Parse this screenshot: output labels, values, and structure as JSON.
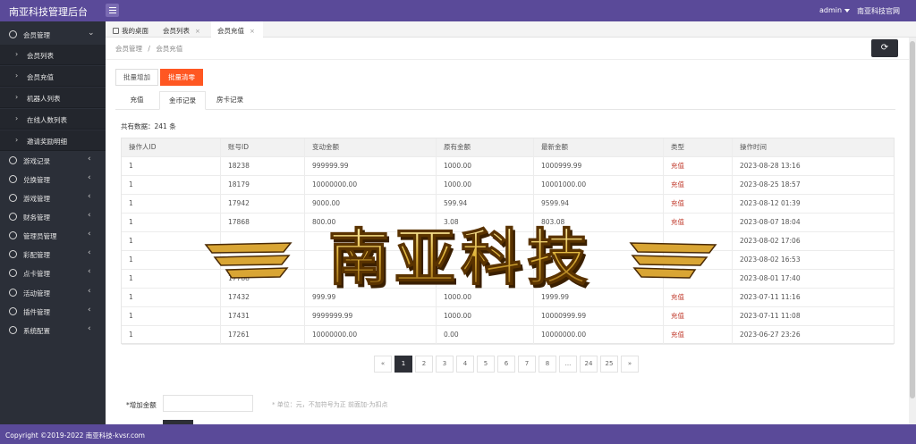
{
  "header": {
    "brand": "南亚科技管理后台",
    "user": "admin",
    "site_link": "南亚科技官网"
  },
  "sidebar": {
    "groups": [
      {
        "label": "会员管理",
        "icon": "user-icon",
        "expanded": true
      },
      {
        "label": "游戏记录",
        "icon": "user-icon"
      },
      {
        "label": "兑换管理",
        "icon": "user-icon"
      },
      {
        "label": "游戏管理",
        "icon": "calendar-icon"
      },
      {
        "label": "财务管理",
        "icon": "dollar-icon"
      },
      {
        "label": "管理员管理",
        "icon": "admin-icon"
      },
      {
        "label": "彩配管理",
        "icon": "user-icon"
      },
      {
        "label": "点卡管理",
        "icon": "card-icon"
      },
      {
        "label": "活动管理",
        "icon": "settings-icon"
      },
      {
        "label": "插件管理",
        "icon": "settings-icon"
      },
      {
        "label": "系统配置",
        "icon": "settings-icon"
      }
    ],
    "subitems": [
      "会员列表",
      "会员充值",
      "机器人列表",
      "在线人数列表",
      "邀请奖励明细"
    ]
  },
  "tabs": {
    "desktop": "我的桌面",
    "members": "会员列表",
    "recharge": "会员充值"
  },
  "breadcrumb": {
    "parent": "会员管理",
    "sep": "/",
    "current": "会员充值"
  },
  "actions": {
    "batch_add": "批量增加",
    "batch_clear": "批量清零"
  },
  "subtabs": {
    "recharge": "充值",
    "coin_record": "金币记录",
    "card_record": "房卡记录"
  },
  "total_text": "共有数据：241 条",
  "table": {
    "headers": [
      "操作人ID",
      "账号ID",
      "变动金额",
      "原有金额",
      "最新金额",
      "类型",
      "操作时间"
    ],
    "rows": [
      [
        "1",
        "18238",
        "999999.99",
        "1000.00",
        "1000999.99",
        "充值",
        "2023-08-28 13:16"
      ],
      [
        "1",
        "18179",
        "10000000.00",
        "1000.00",
        "10001000.00",
        "充值",
        "2023-08-25 18:57"
      ],
      [
        "1",
        "17942",
        "9000.00",
        "599.94",
        "9599.94",
        "充值",
        "2023-08-12 01:39"
      ],
      [
        "1",
        "17868",
        "800.00",
        "3.08",
        "803.08",
        "充值",
        "2023-08-07 18:04"
      ],
      [
        "1",
        "",
        "",
        "",
        "",
        "",
        "2023-08-02 17:06"
      ],
      [
        "1",
        "",
        "",
        "",
        "",
        "",
        "2023-08-02 16:53"
      ],
      [
        "1",
        "17788",
        "",
        "",
        "",
        "",
        "2023-08-01 17:40"
      ],
      [
        "1",
        "17432",
        "999.99",
        "1000.00",
        "1999.99",
        "充值",
        "2023-07-11 11:16"
      ],
      [
        "1",
        "17431",
        "9999999.99",
        "1000.00",
        "10000999.99",
        "充值",
        "2023-07-11 11:08"
      ],
      [
        "1",
        "17261",
        "10000000.00",
        "0.00",
        "10000000.00",
        "充值",
        "2023-06-27 23:26"
      ]
    ]
  },
  "watermark": "南亚科技",
  "pagination": {
    "prev": "«",
    "pages": [
      "1",
      "2",
      "3",
      "4",
      "5",
      "6",
      "7",
      "8",
      "...",
      "24",
      "25"
    ],
    "next": "»",
    "current": "1"
  },
  "form": {
    "label": "*增加金额",
    "hint": "* 单位：元，不加符号为正 前面加-为扣点"
  },
  "footer": {
    "text": "Copyright ©2019-2022 南亚科技-kvsr.com"
  },
  "colors": {
    "header_bg": "#5a4a99",
    "sidebar_bg": "#2b2f38",
    "accent_orange": "#ff5722",
    "type_red": "#c0392b"
  }
}
